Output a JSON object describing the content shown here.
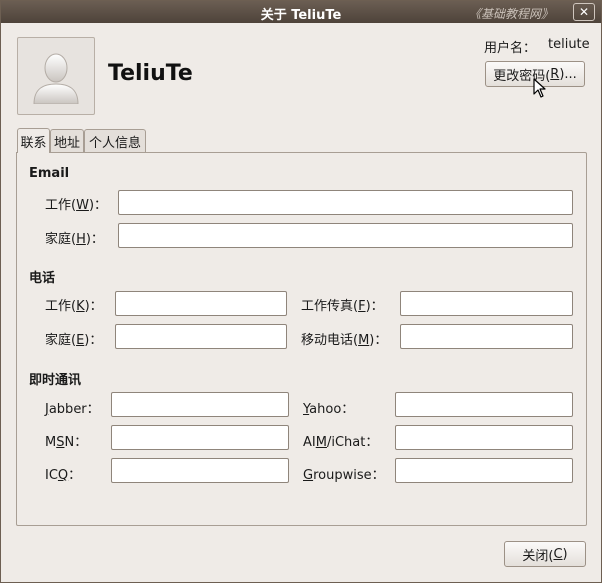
{
  "window": {
    "title": "关于 TeliuTe",
    "watermark": "《基础教程网》",
    "close_glyph": "✕"
  },
  "header": {
    "display_name": "TeliuTe",
    "username_label": "用户名：",
    "username_value": "teliute",
    "change_password": {
      "text": "更改密码(",
      "key": "R",
      "suffix": ")..."
    }
  },
  "tabs": [
    {
      "label": "联系",
      "active": true
    },
    {
      "label": "地址",
      "active": false
    },
    {
      "label": "个人信息",
      "active": false
    }
  ],
  "email": {
    "title": "Email",
    "work": {
      "text": "工作(",
      "key": "W",
      "suffix": ")：",
      "value": ""
    },
    "home": {
      "text": "家庭(",
      "key": "H",
      "suffix": ")：",
      "value": ""
    }
  },
  "phone": {
    "title": "电话",
    "work": {
      "text": "工作(",
      "key": "K",
      "suffix": ")：",
      "value": ""
    },
    "work_fax": {
      "text": "工作传真(",
      "key": "F",
      "suffix": ")：",
      "value": ""
    },
    "home": {
      "text": "家庭(",
      "key": "E",
      "suffix": ")：",
      "value": ""
    },
    "mobile": {
      "text": "移动电话(",
      "key": "M",
      "suffix": ")：",
      "value": ""
    }
  },
  "im": {
    "title": "即时通讯",
    "jabber": {
      "pre": "",
      "key": "J",
      "post": "abber：",
      "value": ""
    },
    "yahoo": {
      "pre": "",
      "key": "Y",
      "post": "ahoo：",
      "value": ""
    },
    "msn": {
      "pre": "M",
      "key": "S",
      "post": "N：",
      "value": ""
    },
    "aim": {
      "pre": "AI",
      "key": "M",
      "post": "/iChat：",
      "value": ""
    },
    "icq": {
      "pre": "IC",
      "key": "Q",
      "post": "：",
      "value": ""
    },
    "groupwise": {
      "pre": "",
      "key": "G",
      "post": "roupwise：",
      "value": ""
    }
  },
  "footer": {
    "close": {
      "text": "关闭(",
      "key": "C",
      "suffix": ")"
    }
  },
  "icons": {
    "avatar": "person-silhouette-icon",
    "cursor": "mouse-pointer-icon"
  }
}
